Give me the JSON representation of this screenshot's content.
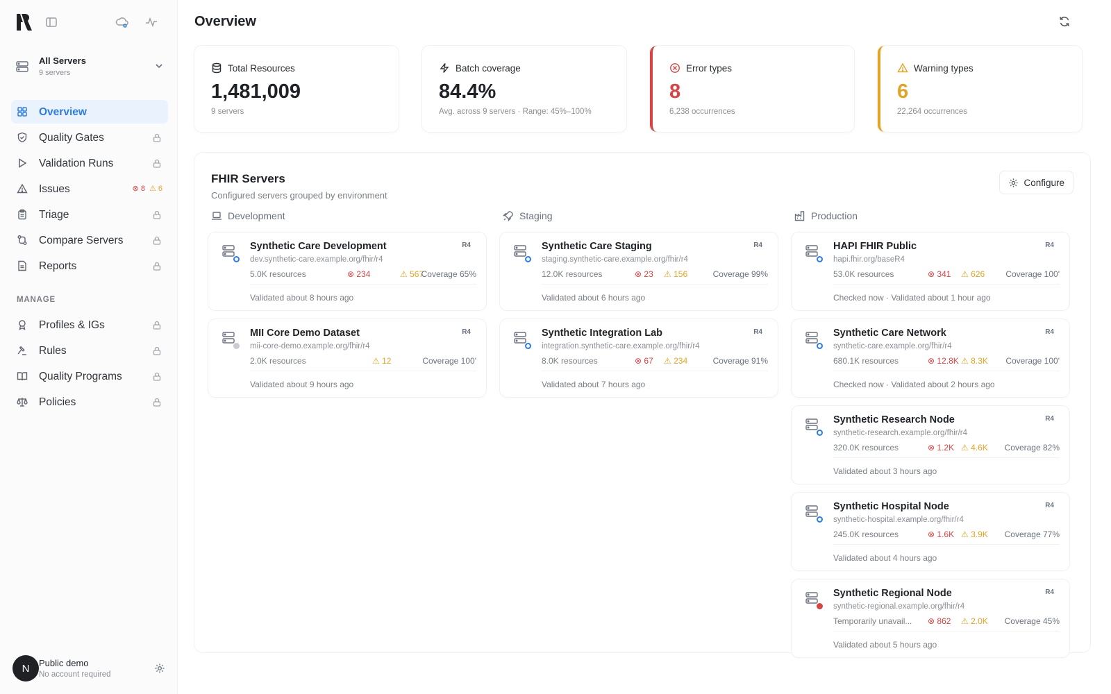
{
  "sidebar": {
    "server_switcher": {
      "title": "All Servers",
      "subtitle": "9 servers"
    },
    "nav": [
      {
        "label": "Overview",
        "icon": "grid-icon",
        "active": true
      },
      {
        "label": "Quality Gates",
        "icon": "shield-check-icon",
        "locked": true
      },
      {
        "label": "Validation Runs",
        "icon": "play-icon",
        "locked": true
      },
      {
        "label": "Issues",
        "icon": "alert-triangle-icon",
        "errors": "8",
        "warnings": "6"
      },
      {
        "label": "Triage",
        "icon": "clipboard-icon",
        "locked": true
      },
      {
        "label": "Compare Servers",
        "icon": "git-compare-icon",
        "locked": true
      },
      {
        "label": "Reports",
        "icon": "file-text-icon",
        "locked": true
      }
    ],
    "manage_label": "MANAGE",
    "manage": [
      {
        "label": "Profiles & IGs",
        "icon": "medal-icon",
        "locked": true
      },
      {
        "label": "Rules",
        "icon": "gavel-icon",
        "locked": true
      },
      {
        "label": "Quality Programs",
        "icon": "book-open-icon",
        "locked": true
      },
      {
        "label": "Policies",
        "icon": "scale-icon",
        "locked": true
      }
    ],
    "user": {
      "initial": "N",
      "name": "Public demo",
      "subtitle": "No account required"
    }
  },
  "header": {
    "title": "Overview"
  },
  "stats": [
    {
      "label": "Total Resources",
      "value": "1,481,009",
      "sub": "9 servers",
      "icon": "database-icon"
    },
    {
      "label": "Batch coverage",
      "value": "84.4%",
      "sub": "Avg. across 9 servers · Range: 45%–100%",
      "icon": "zap-icon"
    },
    {
      "label": "Error types",
      "value": "8",
      "sub": "6,238 occurrences",
      "icon": "x-circle-icon"
    },
    {
      "label": "Warning types",
      "value": "6",
      "sub": "22,264 occurrences",
      "icon": "alert-triangle-icon"
    }
  ],
  "servers_panel": {
    "title": "FHIR Servers",
    "subtitle": "Configured servers grouped by environment",
    "configure_label": "Configure",
    "environments": [
      {
        "label": "Development",
        "icon": "laptop-icon",
        "servers": [
          {
            "name": "Synthetic Care Development",
            "version": "R4",
            "url": "dev.synthetic-care.example.org/fhir/r4",
            "resources": "5.0K resources",
            "errors": "234",
            "warnings": "567",
            "coverage": "Coverage 65%",
            "validated": "Validated about 8 hours ago",
            "status": "blue"
          },
          {
            "name": "MII Core Demo Dataset",
            "version": "R4",
            "url": "mii-core-demo.example.org/fhir/r4",
            "resources": "2.0K resources",
            "errors": "",
            "warnings": "12",
            "coverage": "Coverage 100'",
            "validated": "Validated about 9 hours ago",
            "status": "grey"
          }
        ]
      },
      {
        "label": "Staging",
        "icon": "rocket-icon",
        "servers": [
          {
            "name": "Synthetic Care Staging",
            "version": "R4",
            "url": "staging.synthetic-care.example.org/fhir/r4",
            "resources": "12.0K resources",
            "errors": "23",
            "warnings": "156",
            "coverage": "Coverage 99%",
            "validated": "Validated about 6 hours ago",
            "status": "blue"
          },
          {
            "name": "Synthetic Integration Lab",
            "version": "R4",
            "url": "integration.synthetic-care.example.org/fhir/r4",
            "resources": "8.0K resources",
            "errors": "67",
            "warnings": "234",
            "coverage": "Coverage 91%",
            "validated": "Validated about 7 hours ago",
            "status": "blue"
          }
        ]
      },
      {
        "label": "Production",
        "icon": "factory-icon",
        "servers": [
          {
            "name": "HAPI FHIR Public",
            "version": "R4",
            "url": "hapi.fhir.org/baseR4",
            "resources": "53.0K resources",
            "errors": "341",
            "warnings": "626",
            "coverage": "Coverage 100'",
            "validated": "Checked now · Validated about 1 hour ago",
            "status": "blue"
          },
          {
            "name": "Synthetic Care Network",
            "version": "R4",
            "url": "synthetic-care.example.org/fhir/r4",
            "resources": "680.1K resources",
            "errors": "12.8K",
            "warnings": "8.3K",
            "coverage": "Coverage 100'",
            "validated": "Checked now · Validated about 2 hours ago",
            "status": "blue"
          },
          {
            "name": "Synthetic Research Node",
            "version": "R4",
            "url": "synthetic-research.example.org/fhir/r4",
            "resources": "320.0K resources",
            "errors": "1.2K",
            "warnings": "4.6K",
            "coverage": "Coverage 82%",
            "validated": "Validated about 3 hours ago",
            "status": "blue"
          },
          {
            "name": "Synthetic Hospital Node",
            "version": "R4",
            "url": "synthetic-hospital.example.org/fhir/r4",
            "resources": "245.0K resources",
            "errors": "1.6K",
            "warnings": "3.9K",
            "coverage": "Coverage 77%",
            "validated": "Validated about 4 hours ago",
            "status": "blue"
          },
          {
            "name": "Synthetic Regional Node",
            "version": "R4",
            "url": "synthetic-regional.example.org/fhir/r4",
            "resources": "Temporarily unavail...",
            "errors": "862",
            "warnings": "2.0K",
            "coverage": "Coverage 45%",
            "validated": "Validated about 5 hours ago",
            "status": "red"
          }
        ]
      }
    ]
  }
}
